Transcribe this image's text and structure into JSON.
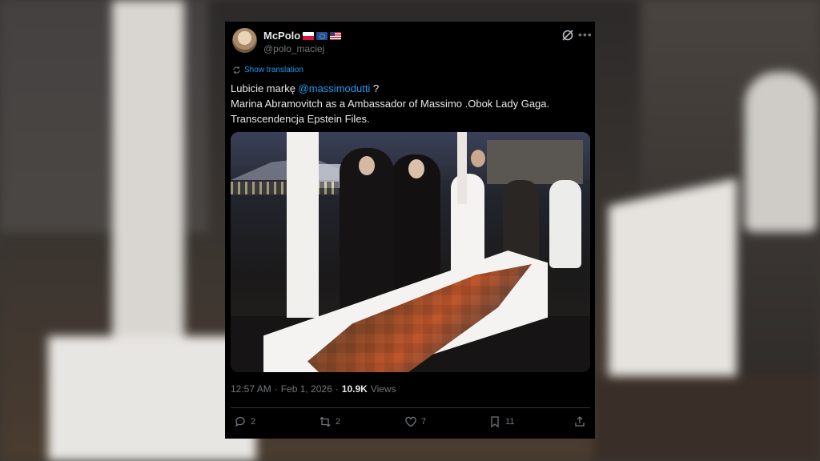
{
  "tweet": {
    "author_name": "McPolo",
    "author_handle": "@polo_maciej",
    "flags": [
      "flag-pl-icon",
      "flag-eu-icon",
      "flag-us-icon"
    ],
    "translate_label": "Show translation",
    "text_prefix": "Lubicie markę ",
    "mention": "@massimodutti",
    "text_suffix": " ?",
    "line2": "Marina Abramovitch as a Ambassador of Massimo .Obok Lady Gaga.",
    "line3": "Transcendencja Epstein Files.",
    "time": "12:57 AM",
    "sep": "·",
    "date": "Feb 1, 2026",
    "views_count": "10.9K",
    "views_label": "Views",
    "actions": {
      "replies": "2",
      "reposts": "2",
      "likes": "7",
      "bookmarks": "11"
    }
  },
  "colors": {
    "card_bg": "#000000",
    "text": "#e7e9ea",
    "muted": "#71767b",
    "link": "#1d9bf0"
  }
}
